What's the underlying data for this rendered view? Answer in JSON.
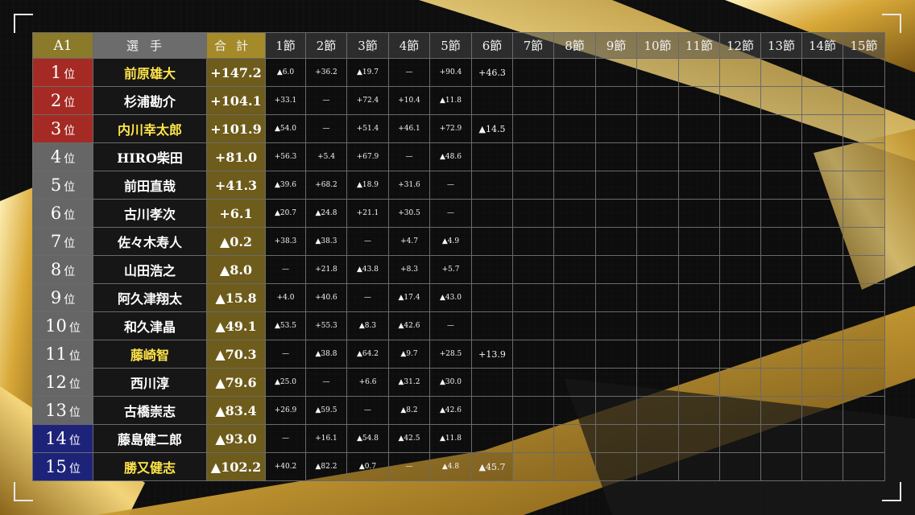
{
  "header": {
    "division": "A1",
    "player": "選手",
    "total": "合計",
    "sections": [
      "1節",
      "2節",
      "3節",
      "4節",
      "5節",
      "6節",
      "7節",
      "8節",
      "9節",
      "10節",
      "11節",
      "12節",
      "13節",
      "14節",
      "15節"
    ]
  },
  "rank_suffix": "位",
  "colors": {
    "gold_name": "#ffe54a",
    "top_rank": "#a52a24",
    "bottom_rank": "#1e237a"
  },
  "rows": [
    {
      "rank": "1",
      "name": "前原雄大",
      "highlight": true,
      "total": "+147.2",
      "scores": [
        "▲6.0",
        "+36.2",
        "▲19.7",
        "—",
        "+90.4",
        "+46.3"
      ]
    },
    {
      "rank": "2",
      "name": "杉浦勘介",
      "highlight": false,
      "total": "+104.1",
      "scores": [
        "+33.1",
        "—",
        "+72.4",
        "+10.4",
        "▲11.8"
      ]
    },
    {
      "rank": "3",
      "name": "内川幸太郎",
      "highlight": true,
      "total": "+101.9",
      "scores": [
        "▲54.0",
        "—",
        "+51.4",
        "+46.1",
        "+72.9",
        "▲14.5"
      ]
    },
    {
      "rank": "4",
      "name": "HIRO柴田",
      "highlight": false,
      "total": "+81.0",
      "scores": [
        "+56.3",
        "+5.4",
        "+67.9",
        "—",
        "▲48.6"
      ]
    },
    {
      "rank": "5",
      "name": "前田直哉",
      "highlight": false,
      "total": "+41.3",
      "scores": [
        "▲39.6",
        "+68.2",
        "▲18.9",
        "+31.6",
        "—"
      ]
    },
    {
      "rank": "6",
      "name": "古川孝次",
      "highlight": false,
      "total": "+6.1",
      "scores": [
        "▲20.7",
        "▲24.8",
        "+21.1",
        "+30.5",
        "—"
      ]
    },
    {
      "rank": "7",
      "name": "佐々木寿人",
      "highlight": false,
      "total": "▲0.2",
      "scores": [
        "+38.3",
        "▲38.3",
        "—",
        "+4.7",
        "▲4.9"
      ]
    },
    {
      "rank": "8",
      "name": "山田浩之",
      "highlight": false,
      "total": "▲8.0",
      "scores": [
        "—",
        "+21.8",
        "▲43.8",
        "+8.3",
        "+5.7"
      ]
    },
    {
      "rank": "9",
      "name": "阿久津翔太",
      "highlight": false,
      "total": "▲15.8",
      "scores": [
        "+4.0",
        "+40.6",
        "—",
        "▲17.4",
        "▲43.0"
      ]
    },
    {
      "rank": "10",
      "name": "和久津晶",
      "highlight": false,
      "total": "▲49.1",
      "scores": [
        "▲53.5",
        "+55.3",
        "▲8.3",
        "▲42.6",
        "—"
      ]
    },
    {
      "rank": "11",
      "name": "藤崎智",
      "highlight": true,
      "total": "▲70.3",
      "scores": [
        "—",
        "▲38.8",
        "▲64.2",
        "▲9.7",
        "+28.5",
        "+13.9"
      ]
    },
    {
      "rank": "12",
      "name": "西川淳",
      "highlight": false,
      "total": "▲79.6",
      "scores": [
        "▲25.0",
        "—",
        "+6.6",
        "▲31.2",
        "▲30.0"
      ]
    },
    {
      "rank": "13",
      "name": "古橋崇志",
      "highlight": false,
      "total": "▲83.4",
      "scores": [
        "+26.9",
        "▲59.5",
        "—",
        "▲8.2",
        "▲42.6"
      ]
    },
    {
      "rank": "14",
      "name": "藤島健二郎",
      "highlight": false,
      "total": "▲93.0",
      "scores": [
        "—",
        "+16.1",
        "▲54.8",
        "▲42.5",
        "▲11.8"
      ]
    },
    {
      "rank": "15",
      "name": "勝又健志",
      "highlight": true,
      "total": "▲102.2",
      "scores": [
        "+40.2",
        "▲82.2",
        "▲0.7",
        "—",
        "▲4.8",
        "▲45.7"
      ]
    }
  ]
}
